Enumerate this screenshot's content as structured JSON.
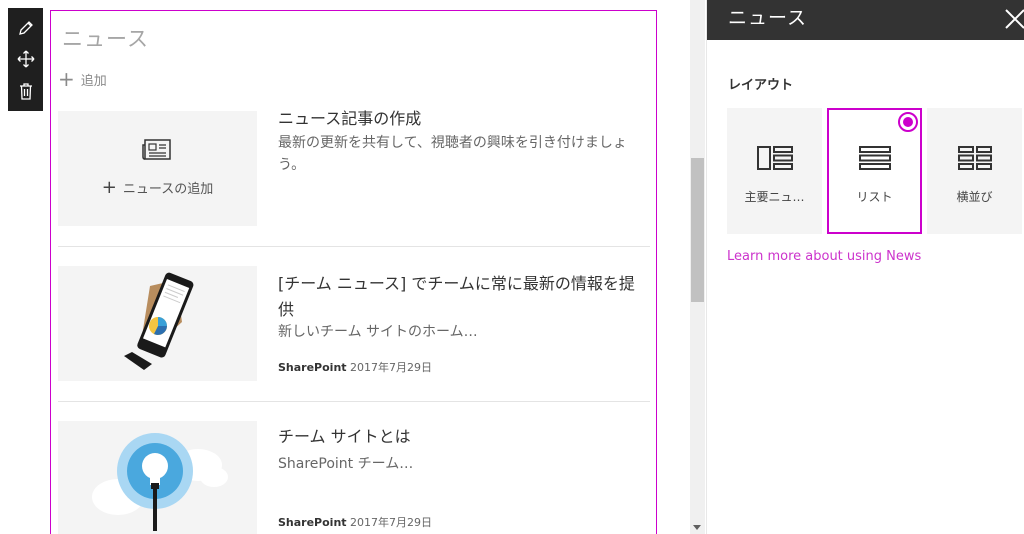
{
  "toolbar": {
    "edit_icon": "pencil-icon",
    "move_icon": "move-icon",
    "delete_icon": "trash-icon"
  },
  "webpart": {
    "title": "ニュース",
    "add_label": "追加",
    "items": [
      {
        "title": "ニュース記事の作成",
        "description": "最新の更新を共有して、視聴者の興味を引き付けましょう。",
        "thumb_label": "ニュースの追加"
      },
      {
        "title": "[チーム ニュース] でチームに常に最新の情報を提供",
        "description": "新しいチーム サイトのホーム…",
        "source": "SharePoint",
        "date": "2017年7月29日"
      },
      {
        "title": "チーム サイトとは",
        "description": "SharePoint チーム…",
        "source": "SharePoint",
        "date": "2017年7月29日"
      }
    ]
  },
  "panel": {
    "title": "ニュース",
    "layout_label": "レイアウト",
    "options": [
      {
        "label": "主要ニュ…",
        "selected": false
      },
      {
        "label": "リスト",
        "selected": true
      },
      {
        "label": "横並び",
        "selected": false
      }
    ],
    "learn_more": "Learn more about using News"
  },
  "colors": {
    "accent": "#cc00cc",
    "header_bg": "#333333",
    "toolbar_bg": "#1f1f1f"
  }
}
